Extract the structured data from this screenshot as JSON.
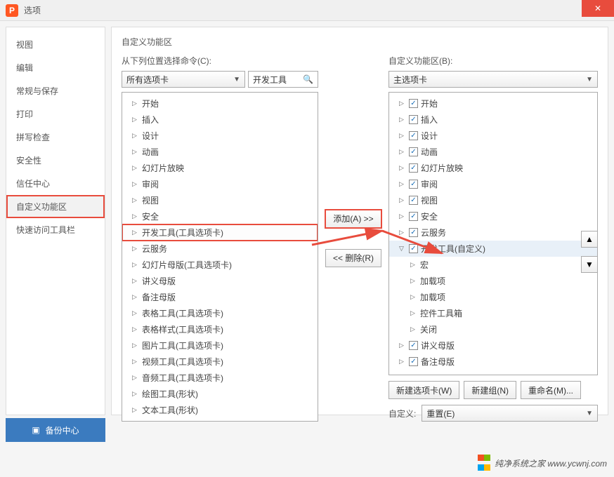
{
  "window": {
    "title": "选项",
    "close": "✕"
  },
  "sidebar": {
    "items": [
      {
        "label": "视图"
      },
      {
        "label": "编辑"
      },
      {
        "label": "常规与保存"
      },
      {
        "label": "打印"
      },
      {
        "label": "拼写检查"
      },
      {
        "label": "安全性"
      },
      {
        "label": "信任中心"
      },
      {
        "label": "自定义功能区",
        "selected": true
      },
      {
        "label": "快速访问工具栏"
      }
    ]
  },
  "content": {
    "title": "自定义功能区",
    "left": {
      "label": "从下列位置选择命令(C):",
      "dropdown": "所有选项卡",
      "search_placeholder": "开发工具",
      "tree": [
        {
          "label": "开始",
          "lvl": 1
        },
        {
          "label": "插入",
          "lvl": 1
        },
        {
          "label": "设计",
          "lvl": 1
        },
        {
          "label": "动画",
          "lvl": 1
        },
        {
          "label": "幻灯片放映",
          "lvl": 1
        },
        {
          "label": "审阅",
          "lvl": 1
        },
        {
          "label": "视图",
          "lvl": 1
        },
        {
          "label": "安全",
          "lvl": 1
        },
        {
          "label": "开发工具(工具选项卡)",
          "lvl": 1,
          "hl": true
        },
        {
          "label": "云服务",
          "lvl": 1
        },
        {
          "label": "幻灯片母版(工具选项卡)",
          "lvl": 1
        },
        {
          "label": "讲义母版",
          "lvl": 1
        },
        {
          "label": "备注母版",
          "lvl": 1
        },
        {
          "label": "表格工具(工具选项卡)",
          "lvl": 1
        },
        {
          "label": "表格样式(工具选项卡)",
          "lvl": 1
        },
        {
          "label": "图片工具(工具选项卡)",
          "lvl": 1
        },
        {
          "label": "视频工具(工具选项卡)",
          "lvl": 1
        },
        {
          "label": "音频工具(工具选项卡)",
          "lvl": 1
        },
        {
          "label": "绘图工具(形状)",
          "lvl": 1
        },
        {
          "label": "文本工具(形状)",
          "lvl": 1
        }
      ]
    },
    "mid": {
      "add": "添加(A) >>",
      "remove": "<< 删除(R)"
    },
    "right": {
      "label": "自定义功能区(B):",
      "dropdown": "主选项卡",
      "tree": [
        {
          "label": "开始",
          "lvl": 1,
          "chk": true
        },
        {
          "label": "插入",
          "lvl": 1,
          "chk": true
        },
        {
          "label": "设计",
          "lvl": 1,
          "chk": true
        },
        {
          "label": "动画",
          "lvl": 1,
          "chk": true
        },
        {
          "label": "幻灯片放映",
          "lvl": 1,
          "chk": true
        },
        {
          "label": "审阅",
          "lvl": 1,
          "chk": true
        },
        {
          "label": "视图",
          "lvl": 1,
          "chk": true
        },
        {
          "label": "安全",
          "lvl": 1,
          "chk": true
        },
        {
          "label": "云服务",
          "lvl": 1,
          "chk": true
        },
        {
          "label": "开发工具(自定义)",
          "lvl": 1,
          "chk": true,
          "sel": true,
          "expanded": true
        },
        {
          "label": "宏",
          "lvl": 2
        },
        {
          "label": "加载项",
          "lvl": 2
        },
        {
          "label": "加载项",
          "lvl": 2
        },
        {
          "label": "控件工具箱",
          "lvl": 2
        },
        {
          "label": "关闭",
          "lvl": 2
        },
        {
          "label": "讲义母版",
          "lvl": 1,
          "chk": true
        },
        {
          "label": "备注母版",
          "lvl": 1,
          "chk": true
        }
      ],
      "actions": {
        "newtab": "新建选项卡(W)",
        "newgroup": "新建组(N)",
        "rename": "重命名(M)..."
      },
      "custom_label": "自定义:",
      "reset": "重置(E)"
    },
    "reorder": {
      "up": "▲",
      "down": "▼"
    }
  },
  "backup": "备份中心",
  "watermark": "纯净系统之家 www.ycwnj.com"
}
